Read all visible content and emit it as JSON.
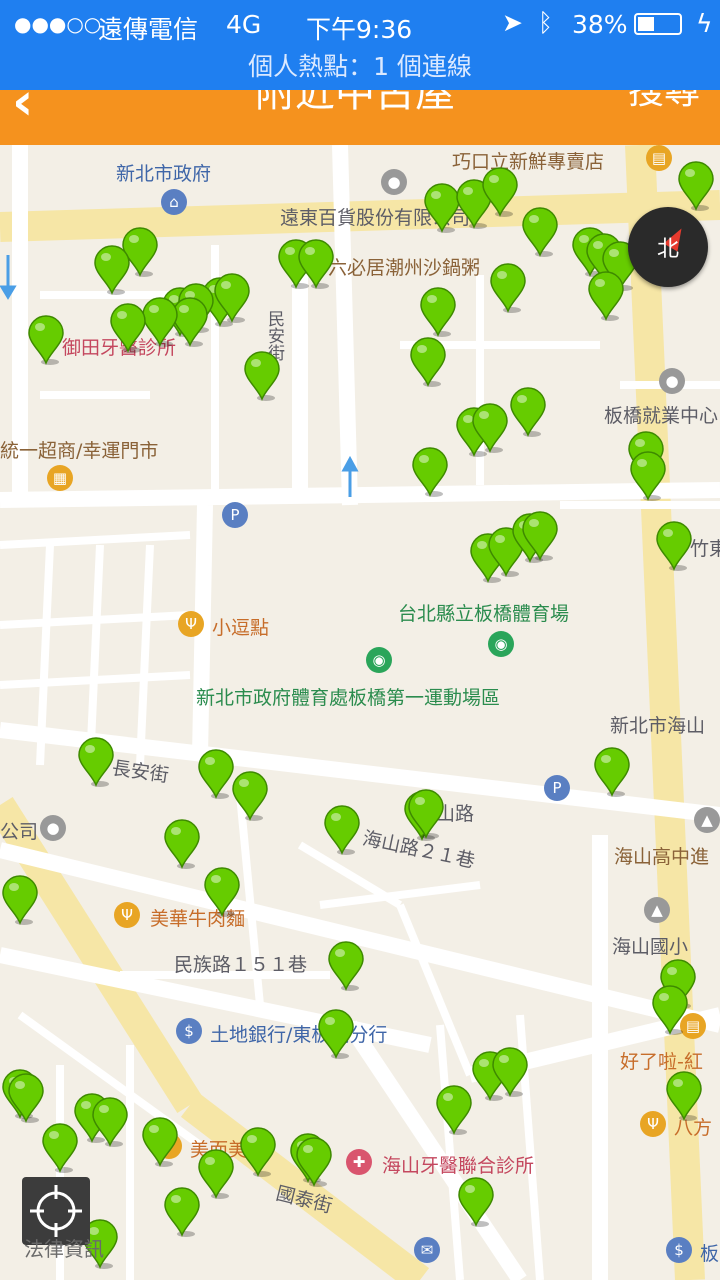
{
  "status_bar": {
    "signal": "●●●○○",
    "carrier": "遠傳電信",
    "network": "4G",
    "time": "下午9:36",
    "battery": "38%"
  },
  "hotspot_banner": "個人熱點：1 個連線",
  "navbar": {
    "title": "附近中古屋",
    "search_label": "搜尋"
  },
  "map": {
    "labels": {
      "gov": "新北市政府",
      "fresh": "巧口立新鮮專賣店",
      "far_eastern": "遠東百貨股份有限公司",
      "hotpot": "六必居潮州沙鍋粥",
      "dental_yutian": "御田牙醫診所",
      "minan_street": "民安街",
      "employment": "板橋就業中心",
      "seven_eleven": "統一超商/幸運門市",
      "zhudong": "竹東",
      "xiaodou": "小逗點",
      "gym": "台北縣立板橋體育場",
      "sports_field": "新北市政府體育處板橋第一運動場區",
      "haishan_area": "新北市海山",
      "changan_street": "長安街",
      "shan_road": "山路",
      "company": "公司",
      "haishan_lane": "海山路２１巷",
      "haishan_high": "海山高中進",
      "beef_noodle": "美華牛肉麵",
      "haishan_elem": "海山國小",
      "minzu_lane": "民族路１５１巷",
      "land_bank": "土地銀行/東板橋分行",
      "haoleila": "好了啦-紅",
      "bafang": "八方",
      "meier": "美而美",
      "haishan_dental": "海山牙醫聯合診所",
      "guotai_street": "國泰街",
      "ban": "板"
    },
    "compass_label": "北",
    "legal_label": "法律資訊",
    "listing_pin_color": "#66cc00"
  }
}
